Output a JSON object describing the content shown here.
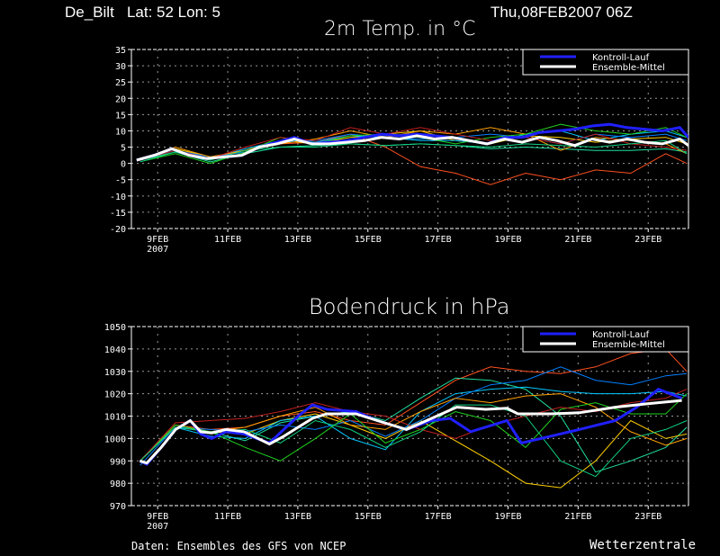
{
  "header": {
    "station": "De_Bilt   Lat: 52 Lon: 5",
    "run": "Thu,08FEB2007 06Z"
  },
  "footer": {
    "source": "Daten: Ensembles des GFS von NCEP",
    "brand": "Wetterzentrale"
  },
  "colors": {
    "control": "#2020ff",
    "mean": "#ffffff",
    "grid": "#9a9a9a",
    "members": [
      "#ff5020",
      "#20e0a0",
      "#ffd000",
      "#00c8ff",
      "#0080ff",
      "#ffa000",
      "#20d020",
      "#c02020",
      "#10d080"
    ]
  },
  "chart_data": [
    {
      "type": "line",
      "title": "2m Temp. in °C",
      "xlabel": "",
      "ylabel": "°C",
      "ylim": [
        -20,
        35
      ],
      "yticks": [
        35,
        30,
        25,
        20,
        15,
        10,
        5,
        0,
        -5,
        -10,
        -15,
        -20
      ],
      "xlim_days_from_9FEB": [
        -0.75,
        15.15
      ],
      "xticks": [
        {
          "day": 0,
          "label": "9FEB",
          "sub": "2007"
        },
        {
          "day": 2,
          "label": "11FEB"
        },
        {
          "day": 4,
          "label": "13FEB"
        },
        {
          "day": 6,
          "label": "15FEB"
        },
        {
          "day": 8,
          "label": "17FEB"
        },
        {
          "day": 10,
          "label": "19FEB"
        },
        {
          "day": 12,
          "label": "21FEB"
        },
        {
          "day": 14,
          "label": "23FEB"
        }
      ],
      "grid": true,
      "legend": {
        "position": "top-right",
        "entries": [
          "Kontroll-Lauf",
          "Ensemble-Mittel"
        ]
      },
      "member_x": [
        -0.5,
        0.5,
        1.5,
        2.5,
        3.5,
        4.5,
        5.5,
        6.5,
        7.5,
        8.5,
        9.5,
        10.5,
        11.5,
        12.5,
        13.5,
        14.5,
        15.1
      ],
      "members": [
        [
          1,
          4,
          1.5,
          4,
          6,
          6.5,
          9,
          5,
          -1,
          -3,
          -6.5,
          -3,
          -5,
          -2,
          -3,
          3,
          0
        ],
        [
          1,
          3.5,
          0.5,
          3,
          5,
          5.5,
          6,
          5.5,
          6,
          5.5,
          4.5,
          5,
          4.5,
          4,
          4,
          4.5,
          3.5
        ],
        [
          1.5,
          4.5,
          2,
          4,
          7,
          6,
          8,
          9,
          10,
          7,
          6,
          8.5,
          8,
          6.5,
          7.5,
          8,
          6
        ],
        [
          1,
          4,
          1.5,
          4.5,
          7,
          6.5,
          8.5,
          8,
          7,
          7,
          6,
          9,
          10,
          7,
          9,
          10,
          8
        ],
        [
          1.5,
          4,
          2,
          3.5,
          6.5,
          7,
          9,
          8,
          7.5,
          8,
          9,
          8,
          6,
          9,
          8,
          9,
          7
        ],
        [
          1,
          5,
          2,
          4,
          6,
          7.5,
          10,
          8,
          10,
          9,
          11,
          9,
          4,
          8,
          7,
          6,
          3
        ],
        [
          0.5,
          3,
          0,
          3.5,
          8,
          6,
          8.5,
          9,
          8,
          6,
          8,
          9,
          12,
          10,
          9,
          11,
          8
        ],
        [
          1,
          4,
          1.5,
          5,
          8,
          7,
          11,
          9,
          11,
          9,
          7,
          8,
          6,
          9,
          6,
          5,
          4
        ],
        [
          0.5,
          3.5,
          1,
          4,
          5,
          5,
          6,
          5.5,
          6,
          5.5,
          5,
          6,
          5.5,
          5,
          6,
          7,
          3
        ]
      ],
      "control_x": [
        -0.6,
        -0.1,
        0.4,
        0.9,
        1.4,
        1.9,
        2.4,
        2.9,
        3.4,
        3.9,
        4.4,
        4.9,
        5.4,
        5.9,
        6.4,
        6.9,
        7.4,
        7.9,
        8.4,
        8.9,
        9.4,
        9.9,
        10.4,
        10.9,
        11.4,
        11.9,
        12.4,
        12.9,
        13.4,
        13.9,
        14.4,
        14.9,
        15.15
      ],
      "control": [
        1,
        2.5,
        4.5,
        2.5,
        1.5,
        2,
        2.5,
        5,
        6.5,
        8,
        6,
        6.5,
        7,
        8,
        9,
        8.5,
        9,
        8.5,
        8,
        7,
        6,
        8,
        8,
        9.5,
        10,
        10.5,
        11.5,
        12,
        11,
        10.5,
        10,
        11,
        8
      ],
      "mean": [
        1,
        2.5,
        4.5,
        2.5,
        1.5,
        2,
        2.5,
        5,
        6,
        7.5,
        6,
        6,
        6.5,
        7,
        8,
        7.5,
        8.5,
        7.5,
        8,
        7,
        6,
        7.5,
        6.5,
        8,
        7,
        5.5,
        7.5,
        6.5,
        7.5,
        6.5,
        6,
        7.5,
        5.5
      ]
    },
    {
      "type": "line",
      "title": "Bodendruck in hPa",
      "xlabel": "",
      "ylabel": "hPa",
      "ylim": [
        970,
        1050
      ],
      "yticks": [
        1050,
        1040,
        1030,
        1020,
        1010,
        1000,
        990,
        980,
        970
      ],
      "xlim_days_from_9FEB": [
        -0.75,
        15.15
      ],
      "xticks": [
        {
          "day": 0,
          "label": "9FEB",
          "sub": "2007"
        },
        {
          "day": 2,
          "label": "11FEB"
        },
        {
          "day": 4,
          "label": "13FEB"
        },
        {
          "day": 6,
          "label": "15FEB"
        },
        {
          "day": 8,
          "label": "17FEB"
        },
        {
          "day": 10,
          "label": "19FEB"
        },
        {
          "day": 12,
          "label": "21FEB"
        },
        {
          "day": 14,
          "label": "23FEB"
        }
      ],
      "grid": true,
      "legend": {
        "position": "top-right",
        "entries": [
          "Kontroll-Lauf",
          "Ensemble-Mittel"
        ]
      },
      "member_x": [
        -0.5,
        0.5,
        1.5,
        2.5,
        3.5,
        4.5,
        5.5,
        6.5,
        7.5,
        8.5,
        9.5,
        10.5,
        11.5,
        12.5,
        13.5,
        14.5,
        15.1
      ],
      "members": [
        [
          990,
          1006,
          1004,
          1005,
          1010,
          1012,
          1008,
          1006,
          1016,
          1026,
          1032,
          1030,
          1029,
          1032,
          1038,
          1040,
          1030
        ],
        [
          990,
          1005,
          1003,
          999,
          1007,
          1010,
          1012,
          1008,
          1018,
          1027,
          1026,
          1022,
          1010,
          985,
          990,
          996,
          1005
        ],
        [
          990,
          1006,
          1003,
          1002,
          1008,
          1011,
          1006,
          1000,
          1008,
          999,
          990,
          980,
          978,
          990,
          1008,
          1000,
          1002
        ],
        [
          990,
          1005,
          1001,
          1000,
          1008,
          1010,
          1000,
          995,
          1012,
          1020,
          1022,
          1023,
          1021,
          1020,
          1020,
          1021,
          1019
        ],
        [
          988,
          1005,
          1004,
          1003,
          1006,
          1004,
          1008,
          1001,
          1008,
          1018,
          1024,
          1026,
          1032,
          1026,
          1024,
          1028,
          1029
        ],
        [
          990,
          1006,
          1003,
          1005,
          1010,
          1014,
          1006,
          1004,
          1012,
          1018,
          1016,
          1019,
          1020,
          1014,
          1003,
          997,
          1000
        ],
        [
          990,
          1006,
          1003,
          996,
          990,
          1000,
          1011,
          998,
          1004,
          1012,
          1008,
          996,
          1013,
          1016,
          1011,
          1011,
          1020
        ],
        [
          990,
          1007,
          1008,
          1009,
          1012,
          1016,
          1012,
          1010,
          1004,
          1000,
          1006,
          1010,
          1014,
          1012,
          1016,
          1018,
          1022
        ],
        [
          990,
          1005,
          1003,
          1004,
          998,
          1008,
          1004,
          996,
          1003,
          1015,
          1015,
          1010,
          990,
          983,
          1000,
          1004,
          1008
        ]
      ],
      "control_x": [
        -0.51,
        -0.31,
        0.1,
        0.51,
        0.93,
        1.23,
        1.54,
        1.95,
        2.47,
        3.19,
        3.6,
        4.01,
        4.42,
        4.83,
        5.66,
        6.27,
        7.1,
        7.82,
        8.35,
        8.93,
        9.97,
        10.38,
        11.21,
        12.03,
        13.06,
        13.67,
        14.29,
        14.96
      ],
      "control": [
        990,
        988.5,
        996,
        1004,
        1008,
        1002,
        1000,
        1003,
        1002,
        998,
        1004,
        1010,
        1015,
        1013,
        1012,
        1008,
        1004,
        1008,
        1009,
        1003,
        1008,
        998,
        1001,
        1004,
        1008,
        1014,
        1022,
        1018
      ],
      "mean_x": [
        -0.51,
        -0.31,
        0.1,
        0.51,
        0.93,
        1.23,
        1.54,
        1.95,
        2.47,
        3.19,
        3.6,
        4.01,
        4.42,
        4.83,
        5.66,
        6.27,
        7.1,
        7.82,
        8.53,
        9.36,
        9.97,
        10.28,
        11.21,
        12.03,
        13.06,
        13.98,
        14.96
      ],
      "mean": [
        990,
        989,
        996,
        1004,
        1008,
        1003,
        1002.5,
        1004,
        1003,
        997.5,
        1001,
        1005,
        1009,
        1011,
        1011,
        1008,
        1004,
        1009,
        1014,
        1013,
        1013.5,
        1011,
        1011,
        1011.5,
        1014,
        1015.5,
        1017
      ]
    }
  ]
}
